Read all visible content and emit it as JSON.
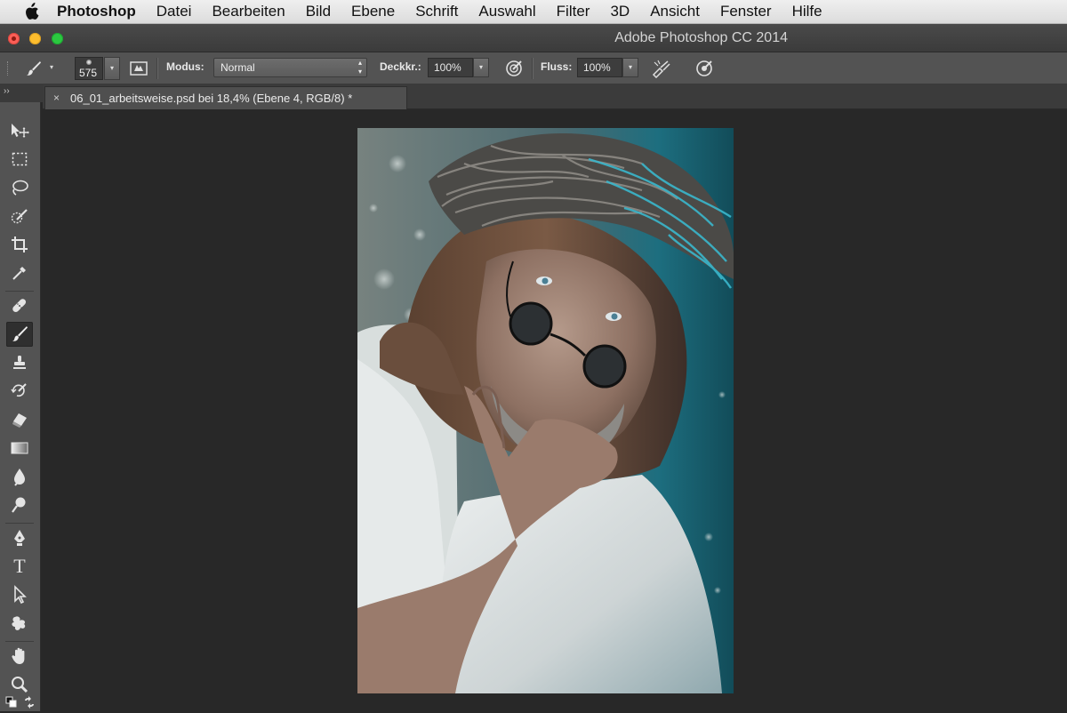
{
  "menubar": {
    "app_name": "Photoshop",
    "items": [
      "Datei",
      "Bearbeiten",
      "Bild",
      "Ebene",
      "Schrift",
      "Auswahl",
      "Filter",
      "3D",
      "Ansicht",
      "Fenster",
      "Hilfe"
    ]
  },
  "window": {
    "title": "Adobe Photoshop CC 2014"
  },
  "options": {
    "brush_size": "575",
    "mode_label": "Modus:",
    "mode_value": "Normal",
    "opacity_label": "Deckkr.:",
    "opacity_value": "100%",
    "flow_label": "Fluss:",
    "flow_value": "100%"
  },
  "document": {
    "tab_title": "06_01_arbeitsweise.psd bei 18,4% (Ebene 4, RGB/8) *",
    "close_glyph": "×"
  },
  "toolbox": {
    "collapse_glyph": "››",
    "active_tool": "brush-tool",
    "tools": [
      "move-tool",
      "marquee-tool",
      "lasso-tool",
      "quick-selection-tool",
      "crop-tool",
      "eyedropper-tool",
      "healing-brush-tool",
      "brush-tool",
      "clone-stamp-tool",
      "history-brush-tool",
      "eraser-tool",
      "gradient-tool",
      "blur-tool",
      "dodge-tool",
      "pen-tool",
      "type-tool",
      "path-selection-tool",
      "custom-shape-tool",
      "hand-tool",
      "zoom-tool"
    ],
    "type_glyph": "T"
  },
  "colors": {
    "ui_dark": "#282828",
    "ui_panel": "#535353",
    "accent_teal": "#1b8a9c"
  }
}
